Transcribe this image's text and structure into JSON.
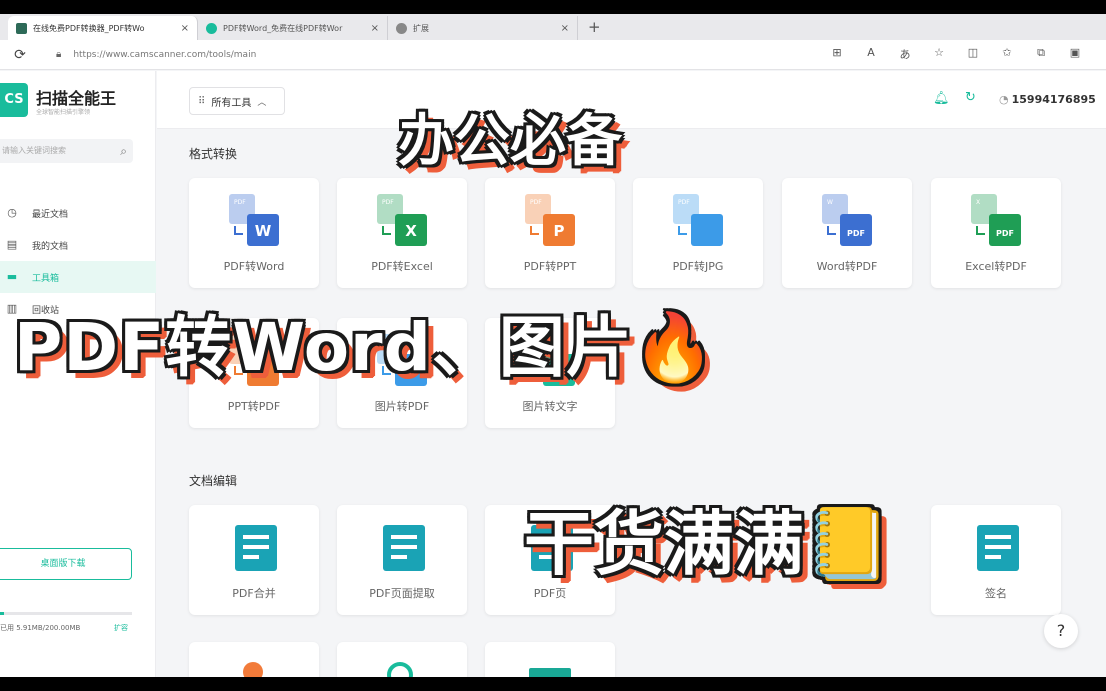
{
  "browser": {
    "tabs": [
      {
        "title": "在线免费PDF转换器_PDF转Wo",
        "favicon_color": "#2d6a58",
        "active": true
      },
      {
        "title": "PDF转Word_免费在线PDF转Wor",
        "favicon_color": "#19bc9c",
        "active": false
      },
      {
        "title": "扩展",
        "favicon_color": "#888888",
        "active": false
      }
    ],
    "close_glyph": "×",
    "new_tab_glyph": "+",
    "url": "https://www.camscanner.com/tools/main",
    "toolbar_icons": [
      "grid-icon",
      "read-aloud-icon",
      "translate-icon",
      "star-icon",
      "split-icon",
      "favorites-icon",
      "extensions-icon",
      "collections-icon"
    ]
  },
  "sidebar": {
    "logo": "CS",
    "brand": "扫描全能王",
    "brand_sub": "全球智能扫描引擎领",
    "search_placeholder": "请输入关键词搜索",
    "nav": [
      {
        "label": "最近文档",
        "icon": "clock-icon",
        "active": false
      },
      {
        "label": "我的文档",
        "icon": "document-icon",
        "active": false
      },
      {
        "label": "工具箱",
        "icon": "toolbox-icon",
        "active": true
      },
      {
        "label": "回收站",
        "icon": "trash-icon",
        "active": false
      }
    ],
    "download_button": "桌面版下载",
    "storage": {
      "text": "已用 5.91MB/200.00MB",
      "more": "扩容",
      "fraction": 0.03
    }
  },
  "header": {
    "all_tools": "所有工具",
    "account": "15994176895"
  },
  "sections": {
    "format": "格式转换",
    "edit": "文档编辑"
  },
  "format_tools": [
    {
      "label": "PDF转Word",
      "badge": "PDF",
      "target": "W",
      "color": "#3c6fd1"
    },
    {
      "label": "PDF转Excel",
      "badge": "PDF",
      "target": "X",
      "color": "#1f9e55"
    },
    {
      "label": "PDF转PPT",
      "badge": "PDF",
      "target": "P",
      "color": "#ef7b32"
    },
    {
      "label": "PDF转JPG",
      "badge": "PDF",
      "target": "",
      "color": "#3c9be8"
    },
    {
      "label": "Word转PDF",
      "badge": "W",
      "target": "PDF",
      "color": "#3c6fd1"
    },
    {
      "label": "Excel转PDF",
      "badge": "X",
      "target": "PDF",
      "color": "#1f9e55"
    },
    {
      "label": "PPT转PDF",
      "badge": "",
      "target": "",
      "color": "#ef7b32"
    },
    {
      "label": "图片转PDF",
      "badge": "",
      "target": "",
      "color": "#3c9be8"
    },
    {
      "label": "图片转文字",
      "badge": "",
      "target": "",
      "color": "#19bc9c"
    }
  ],
  "edit_tools": [
    {
      "label": "PDF合并",
      "color": "#1aa3b5"
    },
    {
      "label": "PDF页面提取",
      "color": "#1aa3b5"
    },
    {
      "label": "PDF页",
      "color": "#1aa3b5"
    },
    {
      "label": "签名",
      "color": "#1aa3b5"
    }
  ],
  "overlay": {
    "line1": "办公必备",
    "line2": "PDF转Word、图片🔥",
    "line3": "干货满满📒"
  },
  "help": "?"
}
